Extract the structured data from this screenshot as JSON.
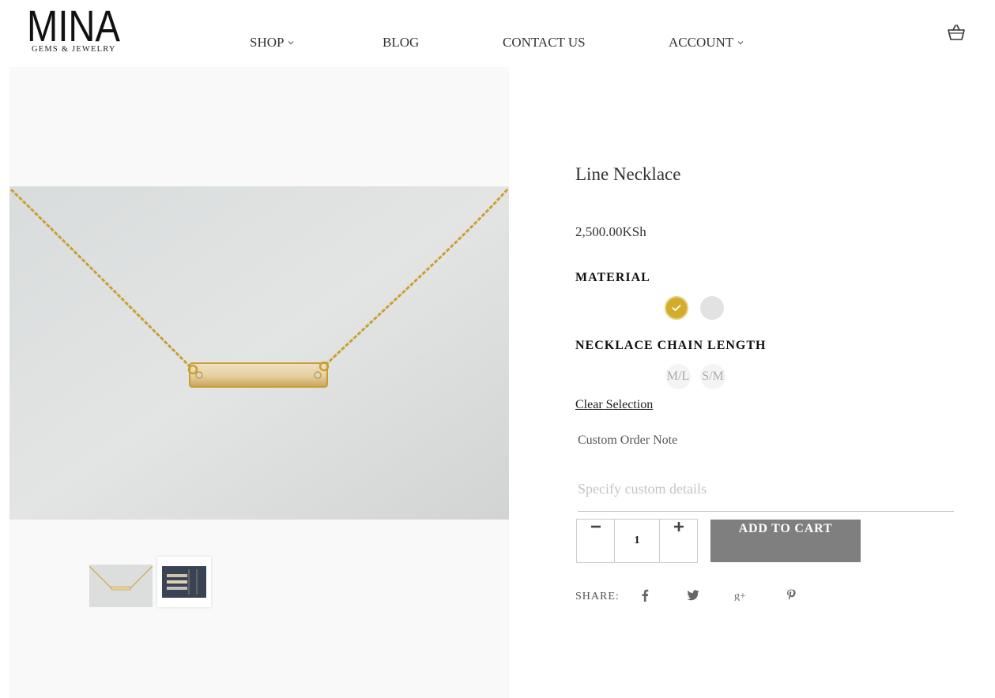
{
  "brand": {
    "logo_mark": "MINA",
    "logo_sub": "GEMS & JEWELRY"
  },
  "nav": {
    "shop": "SHOP",
    "blog": "BLOG",
    "contact": "CONTACT US",
    "account": "ACCOUNT"
  },
  "product": {
    "title": "Line Necklace",
    "price": "2,500.00KSh",
    "material_label": "MATERIAL",
    "material_options": [
      {
        "name": "gold",
        "color": "#d4ac2b",
        "selected": true
      },
      {
        "name": "silver",
        "color": "#e2e2e2",
        "selected": false
      }
    ],
    "length_label": "NECKLACE CHAIN LENGTH",
    "length_options": [
      "M/L",
      "S/M"
    ],
    "clear_selection": "Clear Selection",
    "note_label": "Custom Order Note",
    "note_placeholder": "Specify custom details",
    "quantity": "1",
    "add_to_cart": "ADD TO CART",
    "share_label": "SHARE:"
  },
  "icons": {
    "cart": "basket-icon",
    "share": [
      "facebook-icon",
      "twitter-icon",
      "google-plus-icon",
      "pinterest-icon"
    ],
    "selected": "check-icon"
  },
  "colors": {
    "accent_gold": "#d4ac2b",
    "button_gray": "#7f7f7f",
    "gallery_bg": "#f9f9f9"
  }
}
